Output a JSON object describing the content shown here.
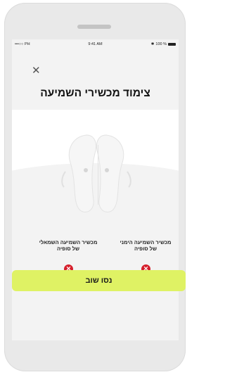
{
  "status_bar": {
    "carrier": "•••○○ PH",
    "time": "9:41 AM",
    "battery": "100 %"
  },
  "title": "צימוד מכשירי השמיעה",
  "devices": {
    "right": {
      "label_line1": "מכשיר השמיעה הימני",
      "label_line2": "של סופיה",
      "status_icon": "error-icon"
    },
    "left": {
      "label_line1": "מכשיר השמיעה השמאלי",
      "label_line2": "של סופיה",
      "status_icon": "error-icon"
    }
  },
  "retry_button": {
    "label": "נסו שוב"
  },
  "colors": {
    "accent": "#dff264",
    "error": "#d61f2c",
    "background": "#f3f3f3"
  }
}
